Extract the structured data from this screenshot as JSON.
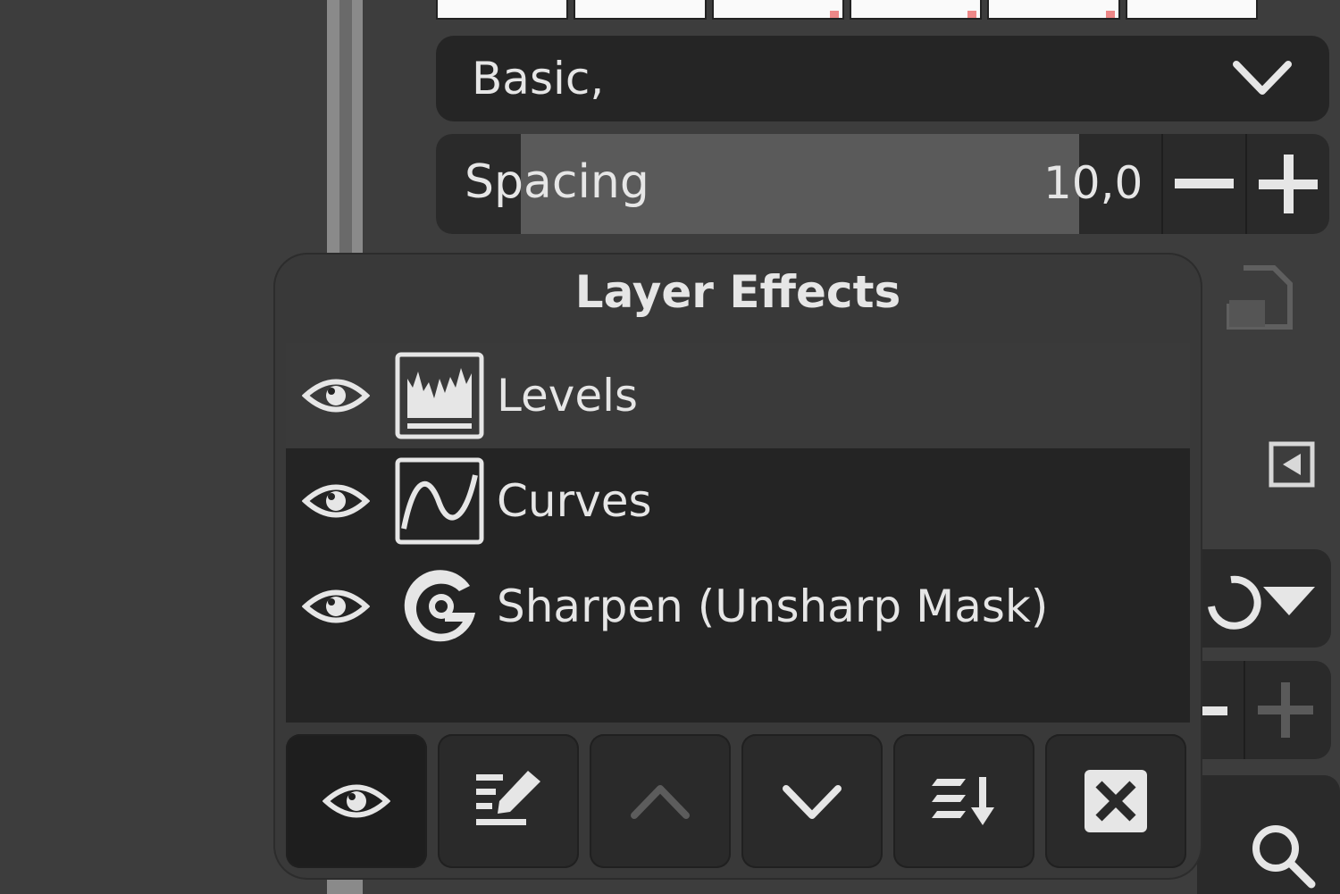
{
  "brush_dropdown": {
    "value": "Basic,"
  },
  "spacing": {
    "label": "Spacing",
    "value": "10,0",
    "fill_fraction": 0.72
  },
  "layer_effects": {
    "title": "Layer Effects",
    "effects": [
      {
        "name": "Levels",
        "icon": "levels-icon",
        "visible": true,
        "selected": true
      },
      {
        "name": "Curves",
        "icon": "curves-icon",
        "visible": true,
        "selected": false
      },
      {
        "name": "Sharpen (Unsharp Mask)",
        "icon": "gegl-icon",
        "visible": true,
        "selected": false
      }
    ],
    "toolbar": [
      {
        "name": "toggle-visibility-button",
        "icon": "eye-icon",
        "active": true
      },
      {
        "name": "edit-effect-button",
        "icon": "edit-icon",
        "active": false
      },
      {
        "name": "raise-effect-button",
        "icon": "chevron-up-icon",
        "active": false,
        "disabled": true
      },
      {
        "name": "lower-effect-button",
        "icon": "chevron-down-icon",
        "active": false
      },
      {
        "name": "merge-effects-button",
        "icon": "merge-down-icon",
        "active": false
      },
      {
        "name": "delete-effect-button",
        "icon": "delete-icon",
        "active": false
      }
    ]
  },
  "colors": {
    "panel": "#393939",
    "list": "#242424",
    "selected_row": "#3a3a3a",
    "text": "#e6e6e6"
  }
}
